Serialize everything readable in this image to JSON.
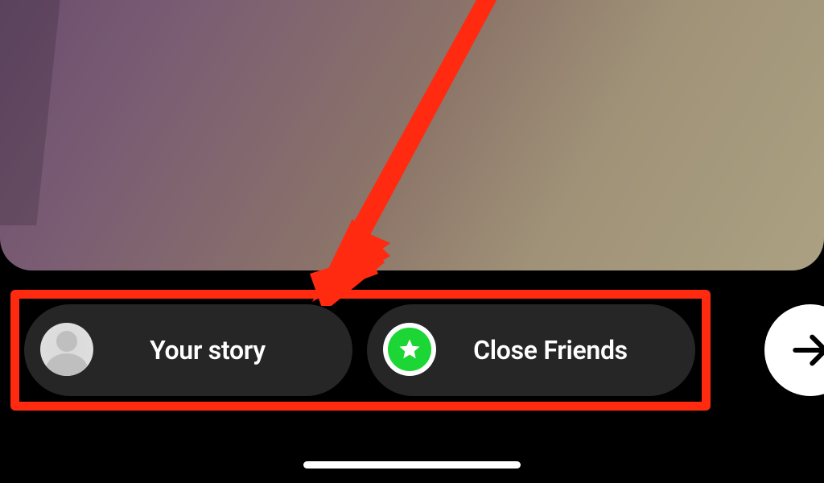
{
  "share_options": {
    "your_story": {
      "label": "Your story"
    },
    "close_friends": {
      "label": "Close Friends"
    }
  },
  "colors": {
    "close_friends_green": "#1bd635",
    "annotation_red": "#ff2a0f",
    "pill_bg": "#262626"
  }
}
